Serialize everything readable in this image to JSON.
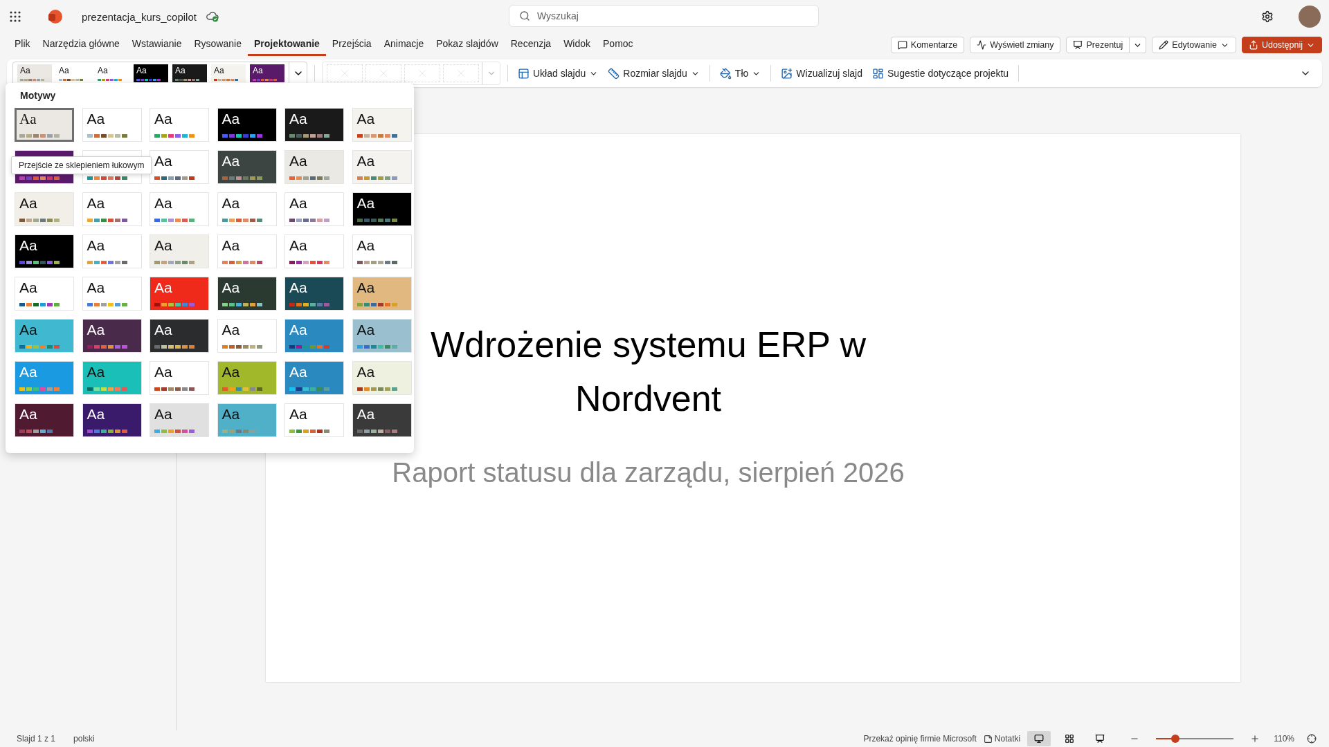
{
  "title_bar": {
    "file_name": "prezentacja_kurs_copilot",
    "search": {
      "placeholder": "Wyszukaj"
    }
  },
  "tabs": [
    {
      "label": "Plik",
      "selected": false
    },
    {
      "label": "Narzędzia główne",
      "selected": false
    },
    {
      "label": "Wstawianie",
      "selected": false
    },
    {
      "label": "Rysowanie",
      "selected": false
    },
    {
      "label": "Projektowanie",
      "selected": true
    },
    {
      "label": "Przejścia",
      "selected": false
    },
    {
      "label": "Animacje",
      "selected": false
    },
    {
      "label": "Pokaz slajdów",
      "selected": false
    },
    {
      "label": "Recenzja",
      "selected": false
    },
    {
      "label": "Widok",
      "selected": false
    },
    {
      "label": "Pomoc",
      "selected": false
    }
  ],
  "actions": [
    {
      "kind": "comments",
      "label": "Komentarze",
      "primary": false,
      "menu": false,
      "split": false
    },
    {
      "kind": "changes",
      "label": "Wyświetl zmiany",
      "primary": false,
      "menu": false,
      "split": false
    },
    {
      "kind": "present",
      "label": "Prezentuj",
      "primary": false,
      "menu": false,
      "split": true
    },
    {
      "kind": "edit",
      "label": "Edytowanie",
      "primary": false,
      "menu": true,
      "split": false
    },
    {
      "kind": "share",
      "label": "Udostępnij",
      "primary": true,
      "menu": true,
      "split": false
    }
  ],
  "ribbon": {
    "gallery": [
      {
        "sample": "Aa",
        "color": "#ebe7e3",
        "swatches": [
          {
            "color": "#a8a89a"
          },
          {
            "color": "#b5ac88"
          },
          {
            "color": "#9c8270"
          },
          {
            "color": "#c99275"
          },
          {
            "color": "#9aa2a8"
          },
          {
            "color": "#b3b3a3"
          }
        ]
      },
      {
        "sample": "Aa",
        "color": "#ffffff",
        "swatches": [
          {
            "color": "#a9bfc6"
          },
          {
            "color": "#c8703d"
          },
          {
            "color": "#7b4a2a"
          },
          {
            "color": "#d8c494"
          },
          {
            "color": "#b7bda4"
          },
          {
            "color": "#7a7a3a"
          }
        ]
      },
      {
        "sample": "Aa",
        "color": "#ffffff",
        "swatches": [
          {
            "color": "#2fa36b"
          },
          {
            "color": "#a6a41b"
          },
          {
            "color": "#e8387c"
          },
          {
            "color": "#8a5cf0"
          },
          {
            "color": "#1fb3d6"
          },
          {
            "color": "#f0911e"
          }
        ]
      },
      {
        "sample": "Aa",
        "color": "#000000",
        "swatches": [
          {
            "color": "#4b5cf0"
          },
          {
            "color": "#7c3ad9"
          },
          {
            "color": "#14c6b8"
          },
          {
            "color": "#3b3bd6"
          },
          {
            "color": "#2fa0f0"
          },
          {
            "color": "#9b35d9"
          }
        ]
      },
      {
        "sample": "Aa",
        "color": "#1a1a1a",
        "swatches": [
          {
            "color": "#6b8a72"
          },
          {
            "color": "#4a5e5a"
          },
          {
            "color": "#a89a72"
          },
          {
            "color": "#c4a094"
          },
          {
            "color": "#a07a7a"
          },
          {
            "color": "#8aa898"
          }
        ]
      },
      {
        "sample": "Aa",
        "color": "#f5f3ee",
        "swatches": [
          {
            "color": "#c8401e"
          },
          {
            "color": "#c4b49a"
          },
          {
            "color": "#d69a70"
          },
          {
            "color": "#c87a3e"
          },
          {
            "color": "#e08a6a"
          },
          {
            "color": "#3e6e9a"
          }
        ]
      },
      {
        "sample": "Aa",
        "color": "#5a1a6a",
        "swatches": [
          {
            "color": "#c040b0"
          },
          {
            "color": "#7a40c0"
          },
          {
            "color": "#e05a3a"
          },
          {
            "color": "#e08a5a"
          },
          {
            "color": "#d03a6a"
          },
          {
            "color": "#e0603a"
          }
        ]
      }
    ],
    "variants": [
      {
        "disabled": true
      },
      {
        "disabled": true
      },
      {
        "disabled": true
      },
      {
        "disabled": true
      }
    ],
    "commands": [
      {
        "kind": "layout",
        "label": "Układ slajdu",
        "menu": true
      },
      {
        "kind": "size",
        "label": "Rozmiar slajdu",
        "menu": true
      },
      {
        "kind": "background",
        "label": "Tło",
        "menu": true
      },
      {
        "kind": "visualize",
        "label": "Wizualizuj slajd",
        "menu": false
      },
      {
        "kind": "designer",
        "label": "Sugestie dotyczące projektu",
        "menu": false
      }
    ]
  },
  "themes_panel": {
    "title": "Motywy",
    "tooltip": "Przejście ze sklepieniem łukowym",
    "themes": [
      {
        "sample": "Aa",
        "selected": true,
        "color": "#ebe7e3",
        "swatches": [
          {
            "color": "#a8a89a"
          },
          {
            "color": "#b5ac88"
          },
          {
            "color": "#9c8270"
          },
          {
            "color": "#c99275"
          },
          {
            "color": "#9aa2a8"
          },
          {
            "color": "#b3b3a3"
          }
        ]
      },
      {
        "sample": "Aa",
        "selected": false,
        "color": "#ffffff",
        "swatches": [
          {
            "color": "#a9bfc6"
          },
          {
            "color": "#c8703d"
          },
          {
            "color": "#7b4a2a"
          },
          {
            "color": "#d8c494"
          },
          {
            "color": "#b7bda4"
          },
          {
            "color": "#7a7a3a"
          }
        ]
      },
      {
        "sample": "Aa",
        "selected": false,
        "color": "#ffffff",
        "swatches": [
          {
            "color": "#2fa36b"
          },
          {
            "color": "#a6a41b"
          },
          {
            "color": "#e8387c"
          },
          {
            "color": "#8a5cf0"
          },
          {
            "color": "#1fb3d6"
          },
          {
            "color": "#f0911e"
          }
        ]
      },
      {
        "sample": "Aa",
        "selected": false,
        "color": "#000000",
        "swatches": [
          {
            "color": "#4b5cf0"
          },
          {
            "color": "#7c3ad9"
          },
          {
            "color": "#14c6b8"
          },
          {
            "color": "#3b3bd6"
          },
          {
            "color": "#2fa0f0"
          },
          {
            "color": "#9b35d9"
          }
        ]
      },
      {
        "sample": "Aa",
        "selected": false,
        "color": "#1a1a1a",
        "swatches": [
          {
            "color": "#6b8a72"
          },
          {
            "color": "#4a5e5a"
          },
          {
            "color": "#a89a72"
          },
          {
            "color": "#c4a094"
          },
          {
            "color": "#a07a7a"
          },
          {
            "color": "#8aa898"
          }
        ]
      },
      {
        "sample": "Aa",
        "selected": false,
        "color": "#f5f3ee",
        "swatches": [
          {
            "color": "#c8401e"
          },
          {
            "color": "#c4b49a"
          },
          {
            "color": "#d69a70"
          },
          {
            "color": "#c87a3e"
          },
          {
            "color": "#e08a6a"
          },
          {
            "color": "#3e6e9a"
          }
        ]
      },
      {
        "selected": false,
        "color": "#5a1a6a",
        "swatches": [
          {
            "color": "#c040b0"
          },
          {
            "color": "#7a40c0"
          },
          {
            "color": "#e05a3a"
          },
          {
            "color": "#e08a5a"
          },
          {
            "color": "#d03a6a"
          },
          {
            "color": "#e0603a"
          }
        ]
      },
      {
        "selected": false,
        "color": "#ffffff",
        "swatches": [
          {
            "color": "#1a9a9a"
          },
          {
            "color": "#f08a3a"
          },
          {
            "color": "#d64a3a"
          },
          {
            "color": "#e07a5a"
          },
          {
            "color": "#b04a3a"
          },
          {
            "color": "#3a8a6a"
          }
        ]
      },
      {
        "sample": "Aa",
        "selected": false,
        "color": "#ffffff",
        "swatches": [
          {
            "color": "#d6502a"
          },
          {
            "color": "#2a6a7a"
          },
          {
            "color": "#8aa0b0"
          },
          {
            "color": "#5a6a7a"
          },
          {
            "color": "#a89a8a"
          },
          {
            "color": "#c03a1a"
          }
        ]
      },
      {
        "sample": "Aa",
        "selected": false,
        "color": "#3d4543",
        "swatches": [
          {
            "color": "#b0603a"
          },
          {
            "color": "#6a7a78"
          },
          {
            "color": "#c09090"
          },
          {
            "color": "#6a7a5a"
          },
          {
            "color": "#a09a4a"
          },
          {
            "color": "#8a9a5a"
          }
        ]
      },
      {
        "sample": "Aa",
        "selected": false,
        "color": "#ebe9e4",
        "swatches": [
          {
            "color": "#e8603a"
          },
          {
            "color": "#e88a4a"
          },
          {
            "color": "#a0a090"
          },
          {
            "color": "#5a6a7a"
          },
          {
            "color": "#7a7a5a"
          },
          {
            "color": "#a0a8a0"
          }
        ]
      },
      {
        "sample": "Aa",
        "selected": false,
        "color": "#f4f3ef",
        "swatches": [
          {
            "color": "#d6805a"
          },
          {
            "color": "#c89a2a"
          },
          {
            "color": "#4a8a7a"
          },
          {
            "color": "#a0a040"
          },
          {
            "color": "#7aa080"
          },
          {
            "color": "#8a9ac0"
          }
        ]
      },
      {
        "sample": "Aa",
        "selected": false,
        "color": "#f1efe8",
        "swatches": [
          {
            "color": "#7a5a3a"
          },
          {
            "color": "#c0a890"
          },
          {
            "color": "#a0a890"
          },
          {
            "color": "#6a7a7a"
          },
          {
            "color": "#8a8a5a"
          },
          {
            "color": "#b0b080"
          }
        ]
      },
      {
        "sample": "Aa",
        "selected": false,
        "color": "#ffffff",
        "swatches": [
          {
            "color": "#e8a83a"
          },
          {
            "color": "#4aa0a8"
          },
          {
            "color": "#3a8a4a"
          },
          {
            "color": "#d6503a"
          },
          {
            "color": "#a07070"
          },
          {
            "color": "#7a5a9a"
          }
        ]
      },
      {
        "sample": "Aa",
        "selected": false,
        "color": "#ffffff",
        "swatches": [
          {
            "color": "#3a6ae0"
          },
          {
            "color": "#5ac0a0"
          },
          {
            "color": "#b090d0"
          },
          {
            "color": "#f08a4a"
          },
          {
            "color": "#e05a5a"
          },
          {
            "color": "#5ab07a"
          }
        ]
      },
      {
        "sample": "Aa",
        "selected": false,
        "color": "#ffffff",
        "swatches": [
          {
            "color": "#4a9a9a"
          },
          {
            "color": "#e8a05a"
          },
          {
            "color": "#d6603a"
          },
          {
            "color": "#e08a6a"
          },
          {
            "color": "#a05a4a"
          },
          {
            "color": "#5a8a7a"
          }
        ]
      },
      {
        "sample": "Aa",
        "selected": false,
        "color": "#ffffff",
        "swatches": [
          {
            "color": "#6a4a6a"
          },
          {
            "color": "#9aa0c0"
          },
          {
            "color": "#6a6a8a"
          },
          {
            "color": "#8a7a9a"
          },
          {
            "color": "#d6a0a0"
          },
          {
            "color": "#c0a0c0"
          }
        ]
      },
      {
        "sample": "Aa",
        "selected": false,
        "color": "#000000",
        "swatches": [
          {
            "color": "#4a6a4a"
          },
          {
            "color": "#3a5a6a"
          },
          {
            "color": "#3a5a5a"
          },
          {
            "color": "#5a7a5a"
          },
          {
            "color": "#4a7a7a"
          },
          {
            "color": "#7a8a4a"
          }
        ]
      },
      {
        "sample": "Aa",
        "selected": false,
        "color": "#000000",
        "swatches": [
          {
            "color": "#5a4ae0"
          },
          {
            "color": "#a090e0"
          },
          {
            "color": "#5ac07a"
          },
          {
            "color": "#2a5a5a"
          },
          {
            "color": "#8a5ae0"
          },
          {
            "color": "#a0b04a"
          }
        ]
      },
      {
        "sample": "Aa",
        "selected": false,
        "color": "#ffffff",
        "swatches": [
          {
            "color": "#e8a03a"
          },
          {
            "color": "#4ab0c0"
          },
          {
            "color": "#e8603a"
          },
          {
            "color": "#6a7ae0"
          },
          {
            "color": "#a0a0a0"
          },
          {
            "color": "#6a6a6a"
          }
        ]
      },
      {
        "sample": "Aa",
        "selected": false,
        "color": "#f0efea",
        "swatches": [
          {
            "color": "#a09a6a"
          },
          {
            "color": "#c8a080"
          },
          {
            "color": "#a0a8c0"
          },
          {
            "color": "#8aa08a"
          },
          {
            "color": "#6a8a6a"
          },
          {
            "color": "#b0a080"
          }
        ]
      },
      {
        "sample": "Aa",
        "selected": false,
        "color": "#ffffff",
        "swatches": [
          {
            "color": "#e8805a"
          },
          {
            "color": "#d6603a"
          },
          {
            "color": "#c8a04a"
          },
          {
            "color": "#d670a0"
          },
          {
            "color": "#e08a5a"
          },
          {
            "color": "#b04a6a"
          }
        ]
      },
      {
        "sample": "Aa",
        "selected": false,
        "color": "#ffffff",
        "swatches": [
          {
            "color": "#8a1a5a"
          },
          {
            "color": "#9a2aa0"
          },
          {
            "color": "#d6a0c0"
          },
          {
            "color": "#e8503a"
          },
          {
            "color": "#d63a5a"
          },
          {
            "color": "#e88a6a"
          }
        ]
      },
      {
        "sample": "Aa",
        "selected": false,
        "color": "#ffffff",
        "swatches": [
          {
            "color": "#7a5a5a"
          },
          {
            "color": "#c0a090"
          },
          {
            "color": "#a0a080"
          },
          {
            "color": "#b0a890"
          },
          {
            "color": "#6a7a8a"
          },
          {
            "color": "#5a6a6a"
          }
        ]
      },
      {
        "sample": "Aa",
        "selected": false,
        "color": "#ffffff",
        "swatches": [
          {
            "color": "#1a5a8a"
          },
          {
            "color": "#e8803a"
          },
          {
            "color": "#1a6a2a"
          },
          {
            "color": "#1aa0d6"
          },
          {
            "color": "#a03ab0"
          },
          {
            "color": "#5ab03a"
          }
        ]
      },
      {
        "sample": "Aa",
        "selected": false,
        "color": "#ffffff",
        "swatches": [
          {
            "color": "#4a7ad6"
          },
          {
            "color": "#e8803a"
          },
          {
            "color": "#a0a0a0"
          },
          {
            "color": "#f0c01a"
          },
          {
            "color": "#5a9ad6"
          },
          {
            "color": "#6ab04a"
          }
        ]
      },
      {
        "sample": "Aa",
        "selected": false,
        "color": "#f02a1a",
        "swatches": [
          {
            "color": "#a01008"
          },
          {
            "color": "#f0a02a"
          },
          {
            "color": "#b0c03a"
          },
          {
            "color": "#4ac0a0"
          },
          {
            "color": "#3a8ad6"
          },
          {
            "color": "#a05ad6"
          }
        ]
      },
      {
        "sample": "Aa",
        "selected": false,
        "color": "#2a3a30",
        "swatches": [
          {
            "color": "#8ad08a"
          },
          {
            "color": "#5ac08a"
          },
          {
            "color": "#4ab0d6"
          },
          {
            "color": "#c0b05a"
          },
          {
            "color": "#e0a03a"
          },
          {
            "color": "#8ac0c0"
          }
        ]
      },
      {
        "sample": "Aa",
        "selected": false,
        "color": "#1a4a55",
        "swatches": [
          {
            "color": "#c02a1a"
          },
          {
            "color": "#e0701a"
          },
          {
            "color": "#e0b02a"
          },
          {
            "color": "#5ab09a"
          },
          {
            "color": "#5a7aa0"
          },
          {
            "color": "#9a5aa0"
          }
        ]
      },
      {
        "sample": "Aa",
        "selected": false,
        "color": "#e0b880",
        "swatches": [
          {
            "color": "#8aa03a"
          },
          {
            "color": "#3a8a7a"
          },
          {
            "color": "#3a6aa0"
          },
          {
            "color": "#a03a2a"
          },
          {
            "color": "#e0702a"
          },
          {
            "color": "#d6a02a"
          }
        ]
      },
      {
        "sample": "Aa",
        "selected": false,
        "color": "#40b8d0",
        "swatches": [
          {
            "color": "#1a6a9a"
          },
          {
            "color": "#f0b01a"
          },
          {
            "color": "#a0c03a"
          },
          {
            "color": "#f0802a"
          },
          {
            "color": "#1a8a6a"
          },
          {
            "color": "#e04a3a"
          }
        ]
      },
      {
        "sample": "Aa",
        "selected": false,
        "color": "#4a2a4a",
        "swatches": [
          {
            "color": "#a01a5a"
          },
          {
            "color": "#e03a6a"
          },
          {
            "color": "#e0603a"
          },
          {
            "color": "#e0903a"
          },
          {
            "color": "#a060e0"
          },
          {
            "color": "#c050e0"
          }
        ]
      },
      {
        "sample": "Aa",
        "selected": false,
        "color": "#2a2c2e",
        "swatches": [
          {
            "color": "#6a6a6a"
          },
          {
            "color": "#c0c0a0"
          },
          {
            "color": "#d6c070"
          },
          {
            "color": "#e0b04a"
          },
          {
            "color": "#e0903a"
          },
          {
            "color": "#d6803a"
          }
        ]
      },
      {
        "sample": "Aa",
        "selected": false,
        "color": "#ffffff",
        "swatches": [
          {
            "color": "#e0801a"
          },
          {
            "color": "#c0602a"
          },
          {
            "color": "#8a5a3a"
          },
          {
            "color": "#a08a5a"
          },
          {
            "color": "#c0b07a"
          },
          {
            "color": "#8a9a7a"
          }
        ]
      },
      {
        "sample": "Aa",
        "selected": false,
        "color": "#2a8ac0",
        "swatches": [
          {
            "color": "#1a3a7a"
          },
          {
            "color": "#a01a8a"
          },
          {
            "color": "#1a9a8a"
          },
          {
            "color": "#6a9a2a"
          },
          {
            "color": "#e0702a"
          },
          {
            "color": "#d63a2a"
          }
        ]
      },
      {
        "sample": "Aa",
        "selected": false,
        "color": "#9ac0d0",
        "swatches": [
          {
            "color": "#2aa0e0"
          },
          {
            "color": "#3a6ad6"
          },
          {
            "color": "#1a8a9a"
          },
          {
            "color": "#3ac0a0"
          },
          {
            "color": "#3a8a5a"
          },
          {
            "color": "#5ab0a0"
          }
        ]
      },
      {
        "sample": "Aa",
        "selected": false,
        "color": "#1a9ae0",
        "swatches": [
          {
            "color": "#f0c01a"
          },
          {
            "color": "#a0d03a"
          },
          {
            "color": "#3ac07a"
          },
          {
            "color": "#e04aa0"
          },
          {
            "color": "#a0a0a0"
          },
          {
            "color": "#f0803a"
          }
        ]
      },
      {
        "sample": "Aa",
        "selected": false,
        "color": "#1ac0b8",
        "swatches": [
          {
            "color": "#0a6a64"
          },
          {
            "color": "#7ae0a0"
          },
          {
            "color": "#c0e04a"
          },
          {
            "color": "#f0a04a"
          },
          {
            "color": "#f07a5a"
          },
          {
            "color": "#e05a5a"
          }
        ]
      },
      {
        "sample": "Aa",
        "selected": false,
        "color": "#ffffff",
        "swatches": [
          {
            "color": "#c84a1a"
          },
          {
            "color": "#a03a2a"
          },
          {
            "color": "#a08a6a"
          },
          {
            "color": "#8a5a4a"
          },
          {
            "color": "#8a8a8a"
          },
          {
            "color": "#8a5a5a"
          }
        ]
      },
      {
        "sample": "Aa",
        "selected": false,
        "color": "#a0b82a",
        "swatches": [
          {
            "color": "#e05a2a"
          },
          {
            "color": "#f0a01a"
          },
          {
            "color": "#3a8aa0"
          },
          {
            "color": "#e0c03a"
          },
          {
            "color": "#8a8a8a"
          },
          {
            "color": "#5a6a1a"
          }
        ]
      },
      {
        "sample": "Aa",
        "selected": false,
        "color": "#2a8ac0",
        "swatches": [
          {
            "color": "#1ac0f0"
          },
          {
            "color": "#1a3a8a"
          },
          {
            "color": "#3ac0d0"
          },
          {
            "color": "#3ab0a0"
          },
          {
            "color": "#3a8a5a"
          },
          {
            "color": "#5aa0a0"
          }
        ]
      },
      {
        "sample": "Aa",
        "selected": false,
        "color": "#eef0e0",
        "swatches": [
          {
            "color": "#a03a1a"
          },
          {
            "color": "#e08a2a"
          },
          {
            "color": "#a09a5a"
          },
          {
            "color": "#7a8a5a"
          },
          {
            "color": "#a0a05a"
          },
          {
            "color": "#5aa08a"
          }
        ]
      },
      {
        "sample": "Aa",
        "selected": false,
        "color": "#501a30",
        "swatches": [
          {
            "color": "#a03a5a"
          },
          {
            "color": "#c04a5a"
          },
          {
            "color": "#a0a0a0"
          },
          {
            "color": "#5ab0d0"
          },
          {
            "color": "#4a7ab0"
          }
        ]
      },
      {
        "sample": "Aa",
        "selected": false,
        "color": "#3a1a6a",
        "swatches": [
          {
            "color": "#a04ad6"
          },
          {
            "color": "#4a7ae0"
          },
          {
            "color": "#3ab0a0"
          },
          {
            "color": "#8ab03a"
          },
          {
            "color": "#e0903a"
          },
          {
            "color": "#e05a3a"
          }
        ]
      },
      {
        "sample": "Aa",
        "selected": false,
        "color": "#e0e0e0",
        "swatches": [
          {
            "color": "#3ab0e0"
          },
          {
            "color": "#8ac03a"
          },
          {
            "color": "#f0a01a"
          },
          {
            "color": "#e04a3a"
          },
          {
            "color": "#e04aa0"
          },
          {
            "color": "#a05ae0"
          }
        ]
      },
      {
        "sample": "Aa",
        "selected": false,
        "color": "#50b0c8",
        "swatches": [
          {
            "color": "#a0b080"
          },
          {
            "color": "#a0a070"
          },
          {
            "color": "#6a7a8a"
          },
          {
            "color": "#8a8a6a"
          },
          {
            "color": "#8aa0a0"
          }
        ]
      },
      {
        "sample": "Aa",
        "selected": false,
        "color": "#ffffff",
        "swatches": [
          {
            "color": "#8ac03a"
          },
          {
            "color": "#3a9a3a"
          },
          {
            "color": "#e0a01a"
          },
          {
            "color": "#e0602a"
          },
          {
            "color": "#c02a1a"
          },
          {
            "color": "#8a8a6a"
          }
        ]
      },
      {
        "sample": "Aa",
        "selected": false,
        "color": "#3a3a3a",
        "swatches": [
          {
            "color": "#6a6a6a"
          },
          {
            "color": "#8aa0b0"
          },
          {
            "color": "#a0b0a0"
          },
          {
            "color": "#c0b0a0"
          },
          {
            "color": "#8a5a6a"
          },
          {
            "color": "#b07a7a"
          }
        ]
      }
    ]
  },
  "slide": {
    "title": "Wdrożenie systemu ERP w Nordvent",
    "subtitle": "Raport statusu dla zarządu, sierpień 2026"
  },
  "status_bar": {
    "slide": "Slajd 1 z 1",
    "language": "polski",
    "feedback": "Przekaż opinię firmie Microsoft",
    "notes": "Notatki",
    "views": [
      {
        "kind": "normal",
        "selected": true
      },
      {
        "kind": "sorter",
        "selected": false
      },
      {
        "kind": "reading",
        "selected": false
      }
    ],
    "zoom": {
      "level": 0.25,
      "reading": "110%"
    }
  }
}
